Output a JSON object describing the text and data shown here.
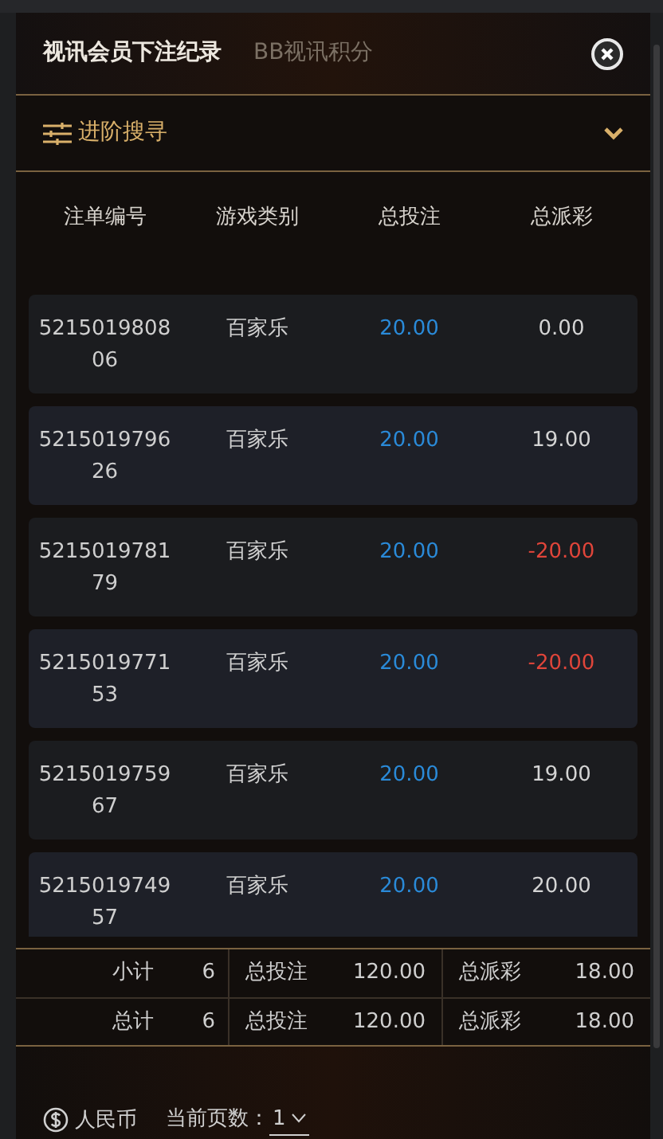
{
  "tabs": [
    {
      "label": "视讯会员下注纪录",
      "selected": true
    },
    {
      "label": "BB视讯积分",
      "selected": false
    }
  ],
  "search": {
    "label": "进阶搜寻",
    "expanded": false
  },
  "columns": [
    "注单编号",
    "游戏类别",
    "总投注",
    "总派彩"
  ],
  "rows": [
    {
      "id": "521501980806",
      "game": "百家乐",
      "bet": "20.00",
      "payout": "0.00",
      "color": "#d4d4d4"
    },
    {
      "id": "521501979626",
      "game": "百家乐",
      "bet": "20.00",
      "payout": "19.00",
      "color": "#d4d4d4"
    },
    {
      "id": "521501978179",
      "game": "百家乐",
      "bet": "20.00",
      "payout": "-20.00",
      "color": "#e0453a"
    },
    {
      "id": "521501977153",
      "game": "百家乐",
      "bet": "20.00",
      "payout": "-20.00",
      "color": "#e0453a"
    },
    {
      "id": "521501975967",
      "game": "百家乐",
      "bet": "20.00",
      "payout": "19.00",
      "color": "#d4d4d4"
    },
    {
      "id": "521501974957",
      "game": "百家乐",
      "bet": "20.00",
      "payout": "20.00",
      "color": "#d4d4d4"
    }
  ],
  "totals": [
    {
      "label": "小计",
      "count": "6",
      "bet_label": "总投注",
      "bet": "120.00",
      "payout_label": "总派彩",
      "payout": "18.00"
    },
    {
      "label": "总计",
      "count": "6",
      "bet_label": "总投注",
      "bet": "120.00",
      "payout_label": "总派彩",
      "payout": "18.00"
    }
  ],
  "footer": {
    "currency": "人民币",
    "page_label": "当前页数：",
    "page": "1"
  }
}
